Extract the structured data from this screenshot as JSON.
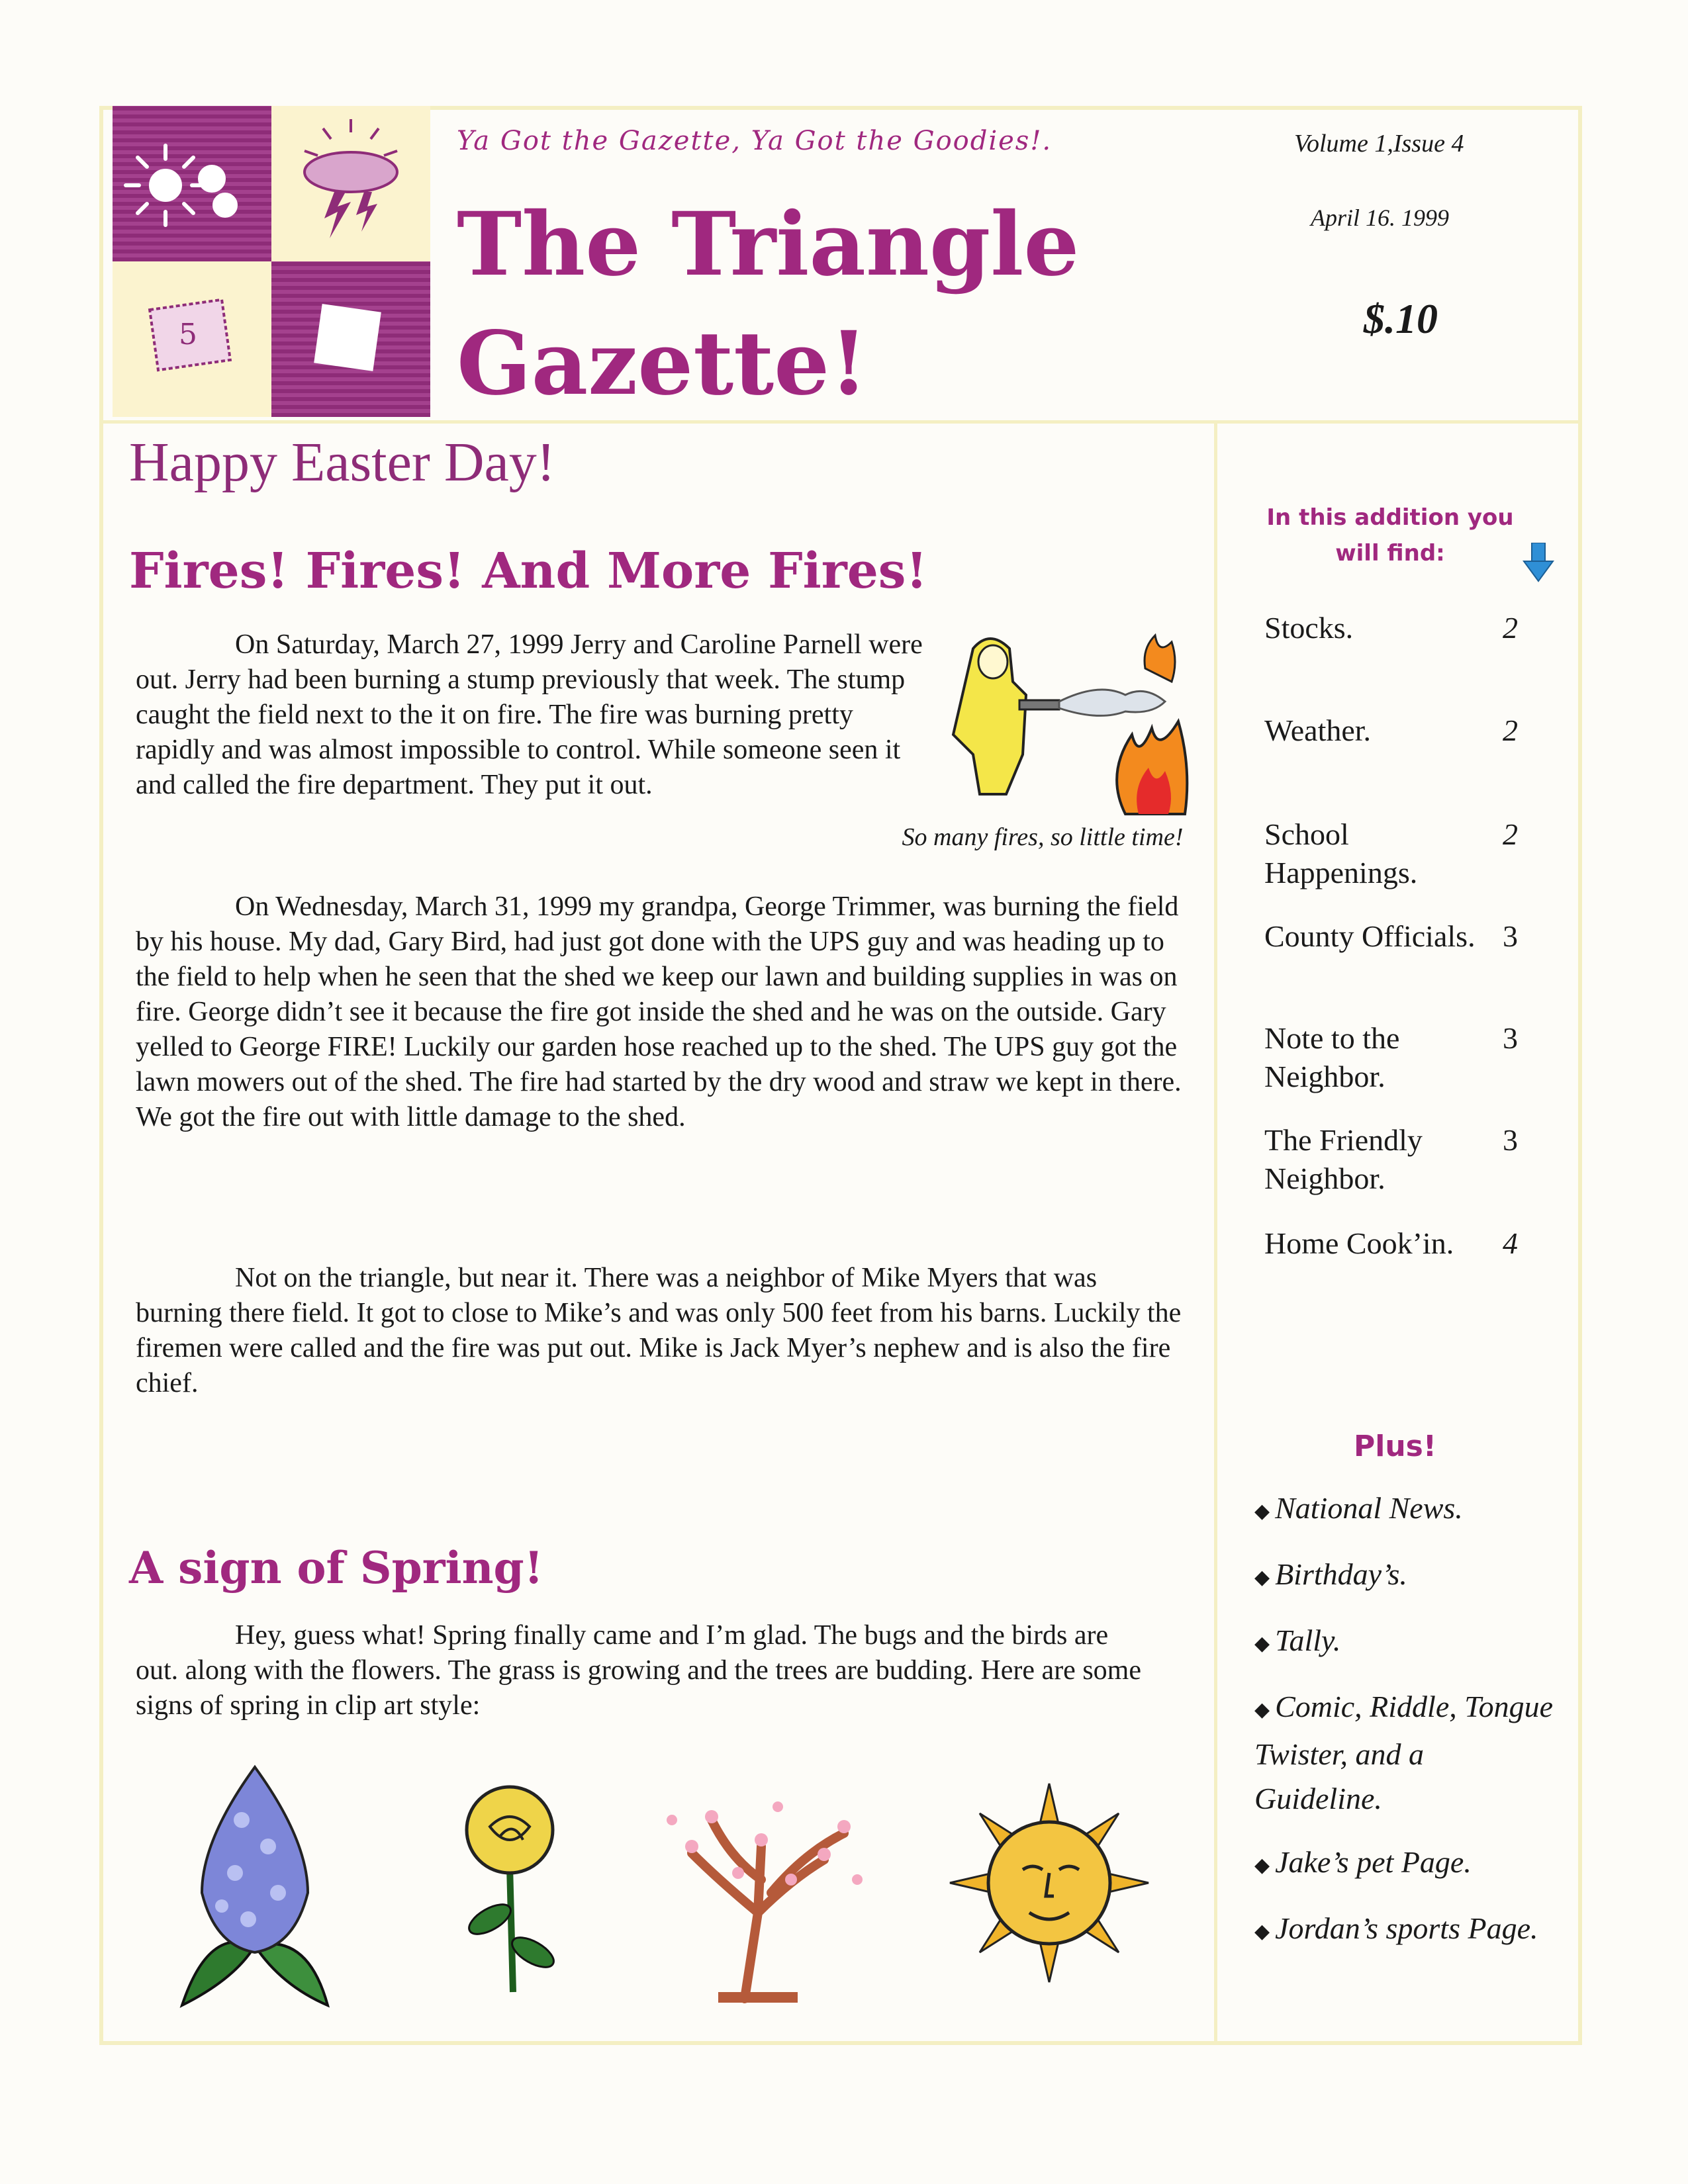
{
  "header": {
    "tagline": "Ya Got the Gazette, Ya Got the Goodies!.",
    "title_line1": "The Triangle",
    "title_line2": "Gazette!",
    "volume": "Volume 1,Issue 4",
    "date": "April 16. 1999",
    "price": "$.10"
  },
  "easter_greeting": "Happy Easter Day!",
  "article1": {
    "headline": "Fires! Fires! And More Fires!",
    "paragraphs": [
      "On Saturday, March 27, 1999 Jerry and Caroline Parnell were out. Jerry had been burning a stump previously that week. The stump caught the field next to the it on fire. The fire was burning pretty rapidly and was almost impossible to control. While someone seen it and called the fire department. They put it out.",
      "On Wednesday, March 31, 1999 my grandpa, George Trimmer, was burning the field by his house. My dad, Gary Bird, had just got done with the UPS guy and was heading up to the field to help when he seen that the shed we keep our lawn and building supplies in was on fire. George didn’t see it because the fire got inside the shed and he was on the outside. Gary yelled to George FIRE! Luckily our garden hose reached up to the shed. The UPS guy got the lawn mowers out of the shed. The fire had started by the dry wood and straw we kept in there. We got the fire out with little damage to the shed.",
      "Not on the triangle, but near it. There was a neighbor of Mike Myers that was burning there field. It got to close to Mike’s and was only 500 feet from his barns. Luckily the firemen were called and the fire was put out. Mike is Jack Myer’s nephew and is also the fire chief."
    ],
    "image_caption": "So many fires, so little time!"
  },
  "article2": {
    "headline": "A sign of Spring!",
    "paragraph": "Hey, guess what! Spring finally came and I’m glad. The bugs and the birds are out. along with the flowers. The grass is growing and the trees are budding. Here are some signs of spring in clip art style:"
  },
  "sidebar": {
    "title": "In this addition you will find:",
    "toc": [
      {
        "label": "Stocks.",
        "page": "2"
      },
      {
        "label": "Weather.",
        "page": "2"
      },
      {
        "label": "School Happenings.",
        "page": "2"
      },
      {
        "label": "County Officials.",
        "page": "3"
      },
      {
        "label": "Note to the Neighbor.",
        "page": "3"
      },
      {
        "label": "The Friendly Neighbor.",
        "page": "3"
      },
      {
        "label": "Home Cook’in.",
        "page": "4"
      }
    ],
    "plus_title": "Plus!",
    "plus_items": [
      "National News.",
      "Birthday’s.",
      "Tally.",
      "Comic, Riddle, Tongue Twister, and a Guideline.",
      "Jake’s pet Page.",
      "Jordan’s sports Page."
    ]
  },
  "colors": {
    "accent": "#a0287f",
    "frame": "#f4efc3",
    "arrow": "#2f8fd6"
  },
  "icons": [
    "sun-cloud-icon",
    "lightning-cloud-icon",
    "stamp-icon",
    "down-arrow-icon",
    "diamond-bullet-icon"
  ],
  "clip_art": [
    "firefighter-hose-clip-art",
    "lilac-clip-art",
    "rose-clip-art",
    "blossom-tree-clip-art",
    "sun-face-clip-art"
  ]
}
